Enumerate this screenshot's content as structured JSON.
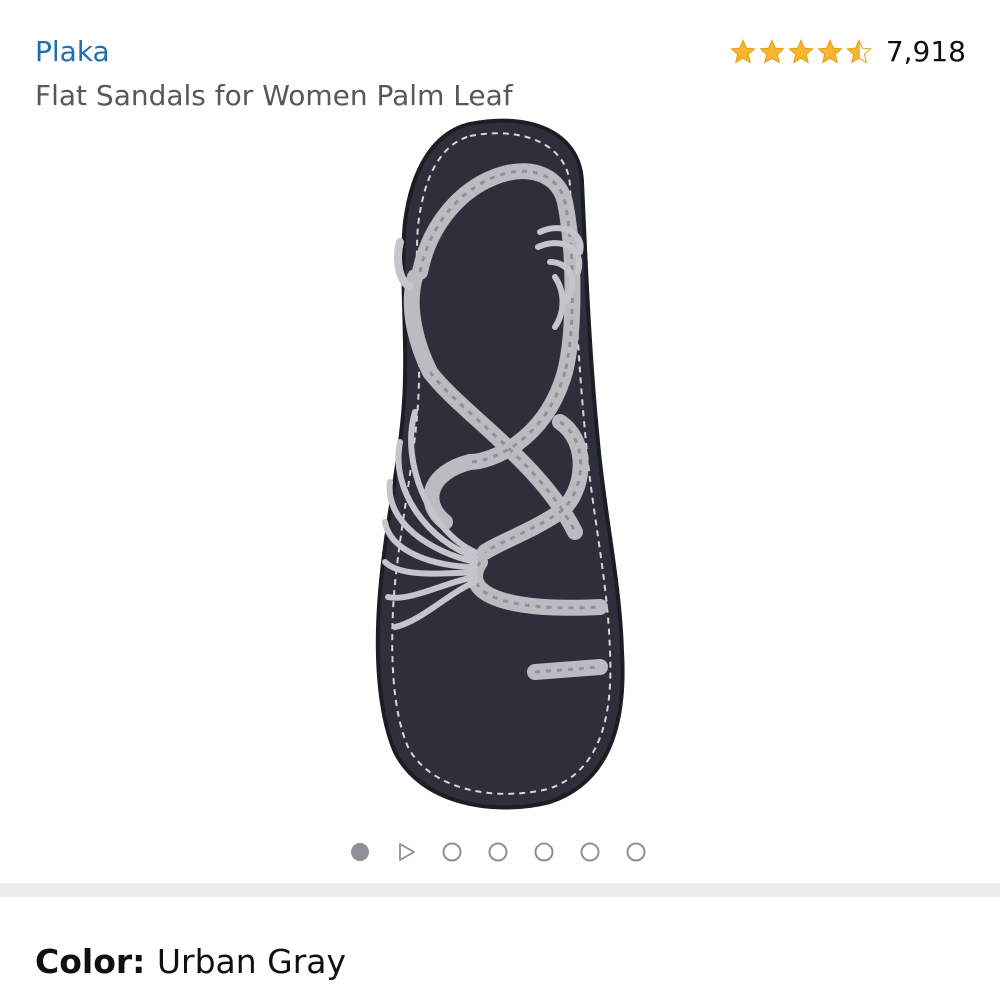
{
  "product": {
    "brand": "Plaka",
    "title": "Flat Sandals for Women Palm Leaf",
    "rating_value": 4.5,
    "rating_count": "7,918",
    "image_alt": "Braided rope sandal, gray straps on dark navy sole",
    "star_color": "#f7b62c",
    "brand_color": "#1f6fb0"
  },
  "gallery": {
    "image_count": 7,
    "active_index": 0,
    "video_index": 1
  },
  "variation": {
    "color_label": "Color:",
    "color_value": "Urban Gray"
  },
  "icons": {
    "star_full": "star-full-icon",
    "star_half": "star-half-icon",
    "play": "play-icon"
  }
}
